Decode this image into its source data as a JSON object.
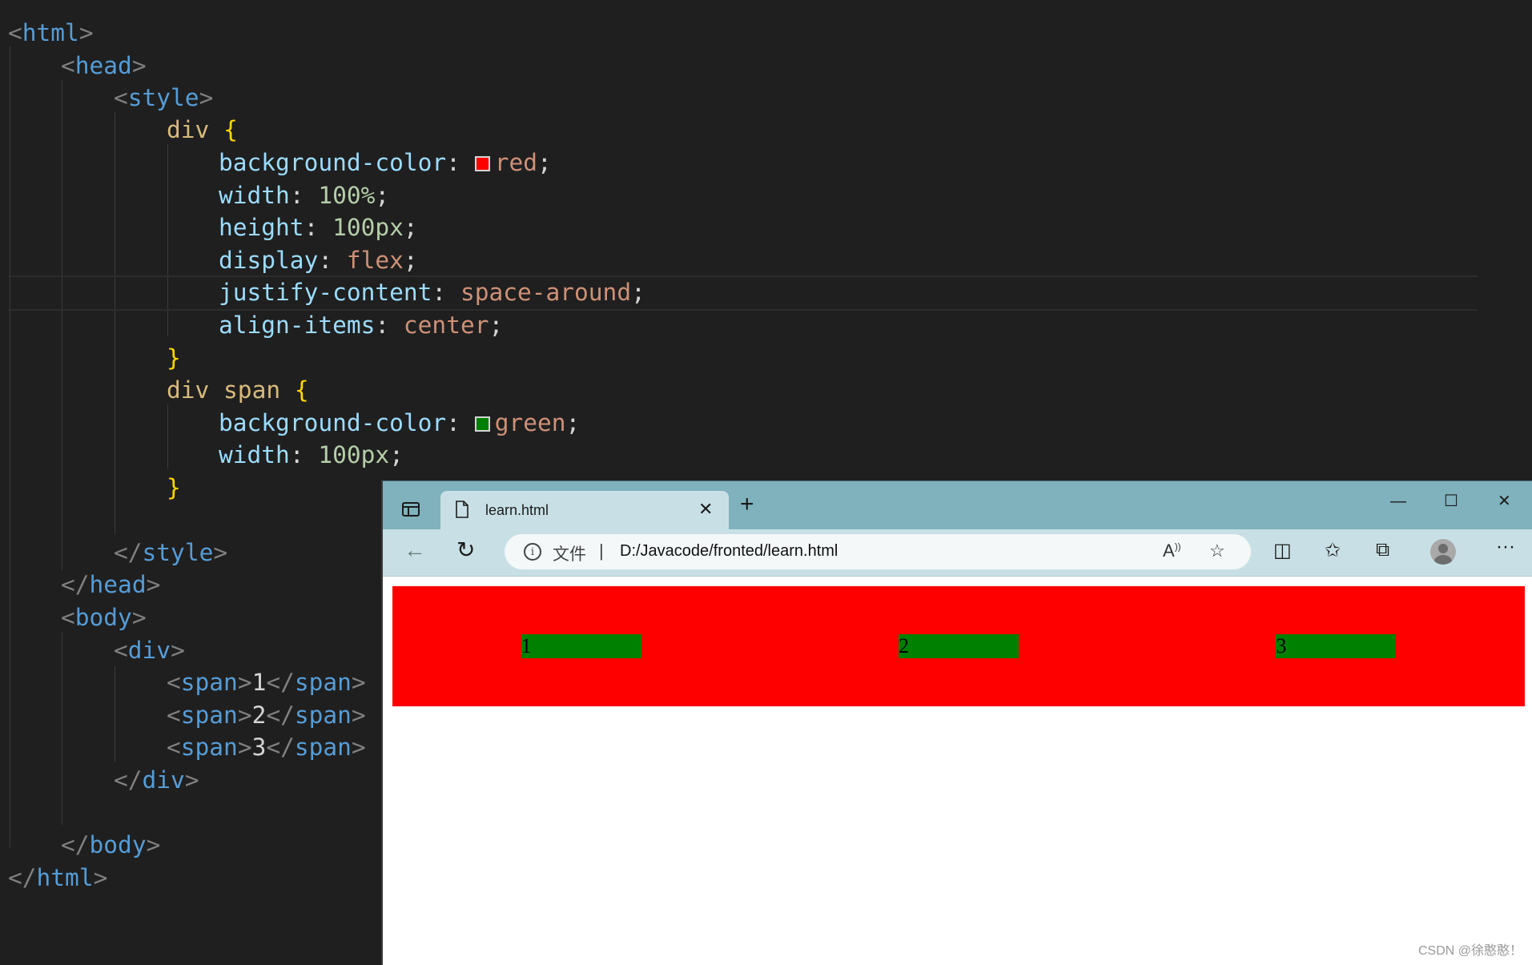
{
  "editor": {
    "lines": {
      "l1_tag": "html",
      "l2_tag": "head",
      "l3_tag": "style",
      "l4_sel": "div",
      "l4_brace": "{",
      "l5_prop": "background-color",
      "l5_val": "red",
      "l6_prop": "width",
      "l6_val": "100%",
      "l7_prop": "height",
      "l7_val": "100px",
      "l8_prop": "display",
      "l8_val": "flex",
      "l9_prop": "justify-content",
      "l9_val": "space-around",
      "l10_prop": "align-items",
      "l10_val": "center",
      "l11_brace": "}",
      "l12_sel": "div span",
      "l12_brace": "{",
      "l13_prop": "background-color",
      "l13_val": "green",
      "l14_prop": "width",
      "l14_val": "100px",
      "l15_brace": "}",
      "l17_tag": "style",
      "l18_tag": "head",
      "l19_tag": "body",
      "l20_tag": "div",
      "span_tag": "span",
      "span1_text": "1",
      "span2_text": "2",
      "span3_text": "3",
      "l24_tag": "div",
      "l26_tag": "body",
      "l27_tag": "html"
    },
    "colors": {
      "swatch_red": "#ff0000",
      "swatch_green": "#008000"
    }
  },
  "browser": {
    "tab_title": "learn.html",
    "address_label": "文件",
    "address_url": "D:/Javacode/fronted/learn.html",
    "page": {
      "spans": [
        "1",
        "2",
        "3"
      ],
      "div_color": "#ff0000",
      "span_color": "#008000"
    }
  },
  "watermark": "CSDN @徐憨憨！"
}
